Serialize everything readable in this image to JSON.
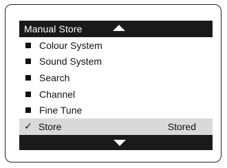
{
  "menu": {
    "title": "Manual Store",
    "items": [
      {
        "label": "Colour System"
      },
      {
        "label": "Sound System"
      },
      {
        "label": "Search"
      },
      {
        "label": "Channel"
      },
      {
        "label": "Fine Tune"
      }
    ],
    "selected": {
      "label": "Store",
      "status": "Stored",
      "check_glyph": "✓"
    },
    "icons": {
      "up": "up-arrow-icon",
      "down": "down-arrow-icon",
      "bullet": "square-bullet-icon",
      "check": "check-icon"
    },
    "colors": {
      "bar": "#1a1a1a",
      "highlight": "#d9d9d9",
      "text": "#111111"
    }
  }
}
